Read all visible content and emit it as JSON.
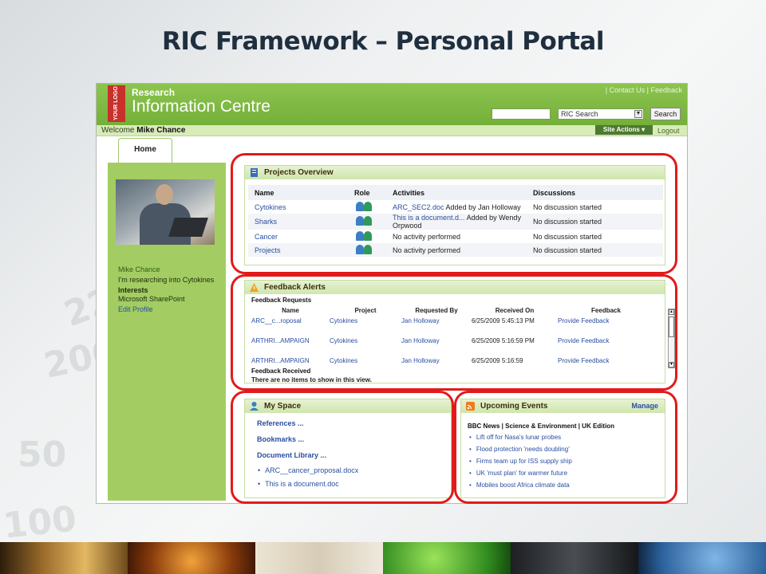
{
  "slide": {
    "title": "RIC Framework – Personal Portal"
  },
  "background_numbers": [
    "225",
    "200",
    "50",
    "100"
  ],
  "header": {
    "logo_text": "YOUR LOGO",
    "brand_small": "Research",
    "brand_big": "Information Centre",
    "top_links": "| Contact Us | Feedback",
    "search_scope": "RIC Search",
    "search_button": "Search",
    "welcome_prefix": "Welcome",
    "user_name": "Mike Chance",
    "site_actions": "Site Actions ▾",
    "logout": "Logout"
  },
  "tabs": [
    {
      "label": "Home"
    }
  ],
  "profile": {
    "name": "Mike Chance",
    "status": "I'm researching into Cytokines",
    "interests_label": "Interests",
    "interests_value": "Microsoft SharePoint",
    "edit_link": "Edit Profile"
  },
  "projects_overview": {
    "title": "Projects Overview",
    "columns": [
      "Name",
      "Role",
      "Activities",
      "Discussions"
    ],
    "rows": [
      {
        "name": "Cytokines",
        "activity_link": "ARC_SEC2.doc",
        "activity_rest": "Added by Jan Holloway",
        "discussion": "No discussion started"
      },
      {
        "name": "Sharks",
        "activity_link": "This is a document.d...",
        "activity_rest": "Added by Wendy Orpwood",
        "discussion": "No discussion started"
      },
      {
        "name": "Cancer",
        "activity_link": "",
        "activity_rest": "No activity performed",
        "discussion": "No discussion started"
      },
      {
        "name": "Projects",
        "activity_link": "",
        "activity_rest": "No activity performed",
        "discussion": "No discussion started"
      }
    ]
  },
  "feedback_alerts": {
    "title": "Feedback Alerts",
    "requests_label": "Feedback Requests",
    "columns": [
      "Name",
      "Project",
      "Requested By",
      "Received On",
      "Feedback"
    ],
    "rows": [
      {
        "name": "ARC__c...roposal",
        "project": "Cytokines",
        "requested_by": "Jan Holloway",
        "received_on": "6/25/2009 5:45:13 PM",
        "feedback": "Provide Feedback"
      },
      {
        "name": "ARTHRI...AMPAIGN",
        "project": "Cytokines",
        "requested_by": "Jan Holloway",
        "received_on": "6/25/2009 5:16:59 PM",
        "feedback": "Provide Feedback"
      },
      {
        "name": "ARTHRI...AMPAIGN",
        "project": "Cytokines",
        "requested_by": "Jan Holloway",
        "received_on": "6/25/2009 5:16:59",
        "feedback": "Provide Feedback"
      }
    ],
    "received_label": "Feedback Received",
    "received_empty": "There are no items to show in this view."
  },
  "my_space": {
    "title": "My Space",
    "links": [
      "References ...",
      "Bookmarks ...",
      "Document Library ..."
    ],
    "documents": [
      "ARC__cancer_proposal.docx",
      "This is a document.doc"
    ]
  },
  "upcoming_events": {
    "title": "Upcoming Events",
    "manage": "Manage",
    "source": "BBC News | Science & Environment | UK Edition",
    "items": [
      "Lift off for Nasa's lunar probes",
      "Flood protection 'needs doubling'",
      "Firms team up for ISS supply ship",
      "UK 'must plan' for warmer future",
      "Mobiles boost Africa climate data"
    ]
  },
  "colors": {
    "portal_green": "#74b039",
    "highlight_red": "#e21a1a",
    "link_blue": "#2a4fa0"
  }
}
